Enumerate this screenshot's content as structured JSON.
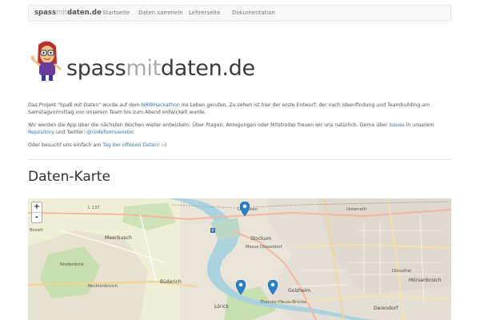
{
  "navbar": {
    "brand_part1": "spass",
    "brand_part2": "mit",
    "brand_part3": "daten.de",
    "links": [
      "Startseite",
      "Daten sammeln",
      "Lehrerseite",
      "Dokumentation"
    ]
  },
  "logo": {
    "part1": "spass",
    "part2": "mit",
    "part3": "daten.de"
  },
  "intro": {
    "p1_a": "Das Projekt \"Spaß mit Daten\" wurde auf dem ",
    "p1_link": "NRWHackathon",
    "p1_b": " ins Leben gerufen. Zu sehen ist hier der erste Entwurf, der nach Ideenfindung und Teambuilding am Samstagvormittag von unserem Team bis zum Abend entwickelt wurde.",
    "p2_a": "Wir werden die App über die nächsten Wochen weiter entwickeln. Über Fragen, Anregungen oder Mitstreiter freuen wir uns natürlich. Gerne über ",
    "p2_link1": "Issues",
    "p2_b": " in unserem ",
    "p2_link2": "Repository",
    "p2_c": " und Twitter: ",
    "p2_link3": "@codeformuenster",
    "p2_d": ".",
    "p3_a": "Oder besucht uns einfach am ",
    "p3_link": "Tag der offenen Daten!",
    "p3_b": " :-)"
  },
  "section": {
    "title": "Daten-Karte"
  },
  "map": {
    "zoom_in": "+",
    "zoom_out": "-",
    "labels": [
      "L 137",
      "Bovert",
      "Meerbusch",
      "Niederdonk",
      "Büderich",
      "Necklenbroich",
      "Lörick",
      "Stockum",
      "Messe Düsseldorf",
      "Golzheim",
      "Derendorf",
      "Mörsenbroich",
      "Unterrath",
      "Düsseltal",
      "Theodor-Heuss-Brücke",
      "Lohausen"
    ],
    "marker_color": "#2a81cb"
  },
  "colors": {
    "link": "#337ab7",
    "river": "#aad3df",
    "forest": "#add19e"
  }
}
